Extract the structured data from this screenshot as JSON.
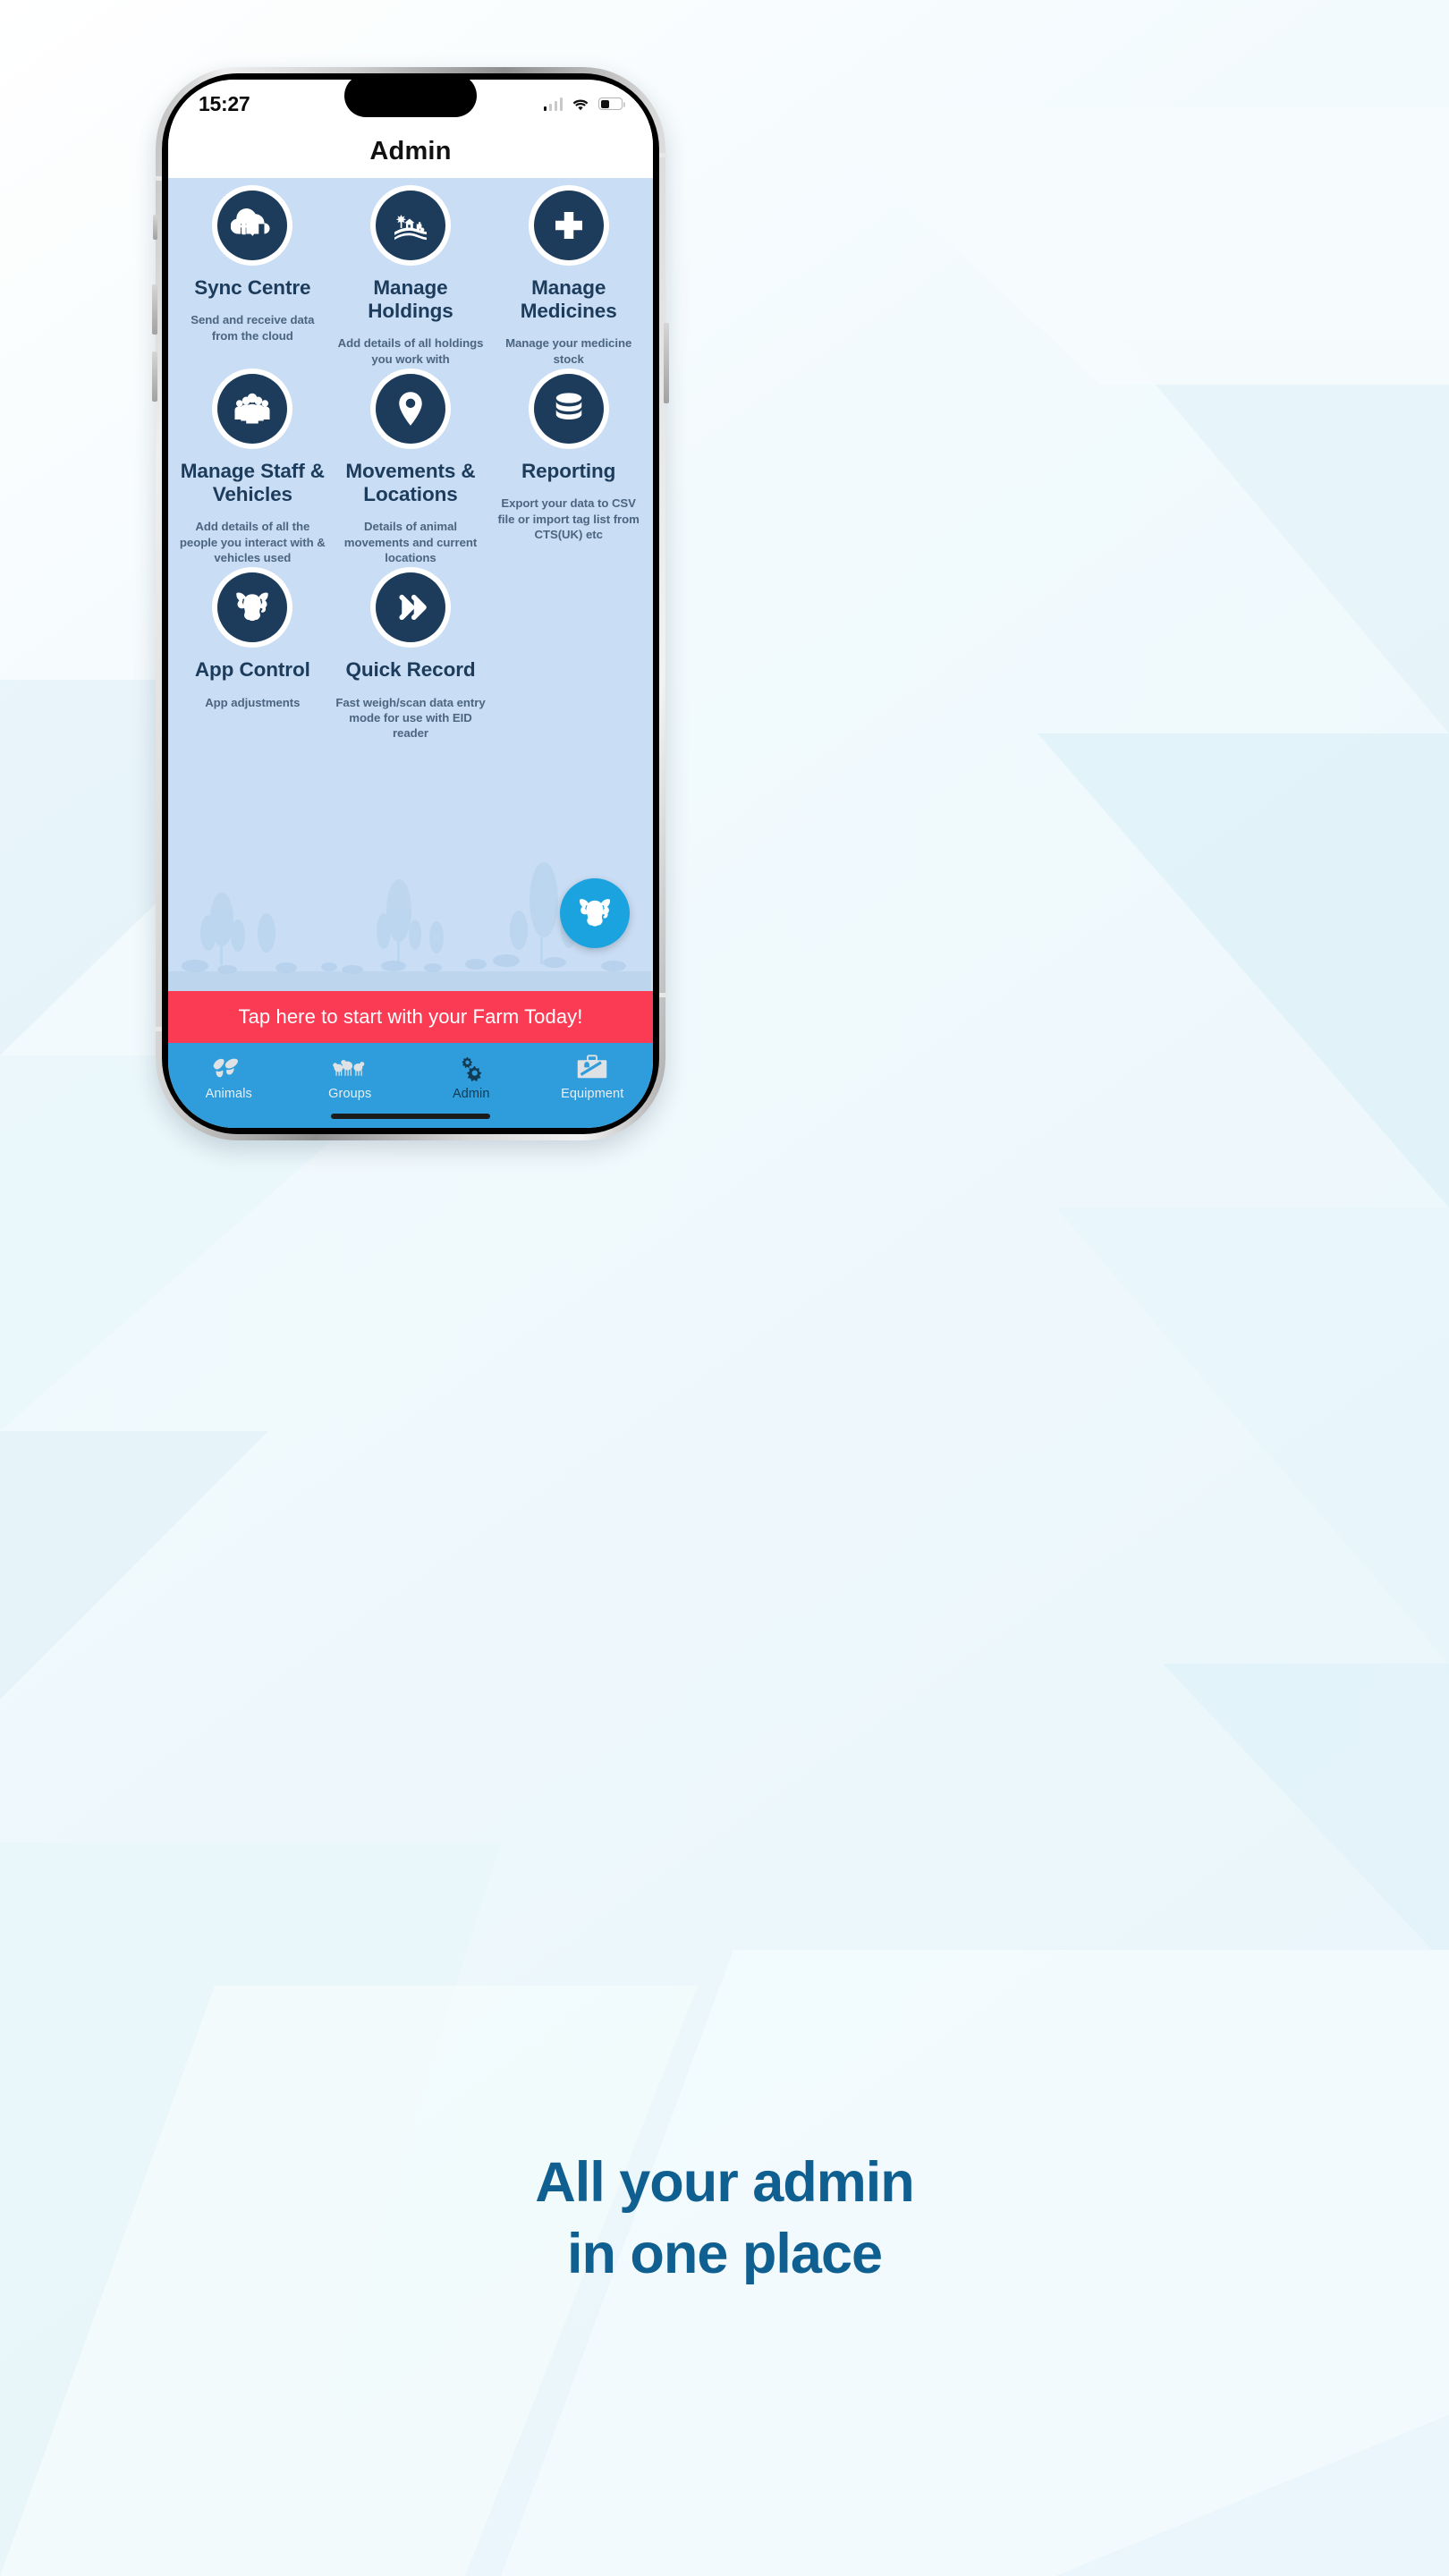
{
  "status_bar": {
    "time": "15:27",
    "signal_icon": "cellular-bars-icon",
    "wifi_icon": "wifi-icon",
    "battery_icon": "battery-icon"
  },
  "nav": {
    "title": "Admin"
  },
  "tiles": [
    {
      "icon": "cloud-sync-icon",
      "title": "Sync Centre",
      "subtitle": "Send and receive data from the cloud"
    },
    {
      "icon": "farm-landscape-icon",
      "title": "Manage Holdings",
      "subtitle": "Add details of all holdings you work with"
    },
    {
      "icon": "medical-cross-icon",
      "title": "Manage Medicines",
      "subtitle": "Manage your medicine stock"
    },
    {
      "icon": "people-group-icon",
      "title": "Manage Staff & Vehicles",
      "subtitle": "Add details of all the people you interact with & vehicles used"
    },
    {
      "icon": "map-pin-icon",
      "title": "Movements & Locations",
      "subtitle": "Details of animal movements and current locations"
    },
    {
      "icon": "database-icon",
      "title": "Reporting",
      "subtitle": "Export your data to CSV file or import tag list from CTS(UK) etc"
    },
    {
      "icon": "cow-head-icon",
      "title": "App Control",
      "subtitle": "App adjustments"
    },
    {
      "icon": "double-chevron-right-icon",
      "title": "Quick Record",
      "subtitle": "Fast weigh/scan data entry mode for use with EID reader"
    }
  ],
  "fab": {
    "icon": "cow-head-icon"
  },
  "banner": {
    "text": "Tap here to start with your Farm Today!"
  },
  "tabbar": {
    "items": [
      {
        "icon": "cattle-icon",
        "label": "Animals",
        "active": false
      },
      {
        "icon": "sheep-flock-icon",
        "label": "Groups",
        "active": false
      },
      {
        "icon": "gears-icon",
        "label": "Admin",
        "active": true
      },
      {
        "icon": "equipment-icon",
        "label": "Equipment",
        "active": false
      }
    ]
  },
  "caption": {
    "line1": "All your admin",
    "line2": "in one place"
  },
  "colors": {
    "navy": "#1d3c5c",
    "content_bg": "#c9ddf4",
    "banner_red": "#fb3b54",
    "tabbar_blue": "#2f9ddb",
    "fab_blue": "#1aa3de",
    "caption_blue": "#0f5f91"
  }
}
